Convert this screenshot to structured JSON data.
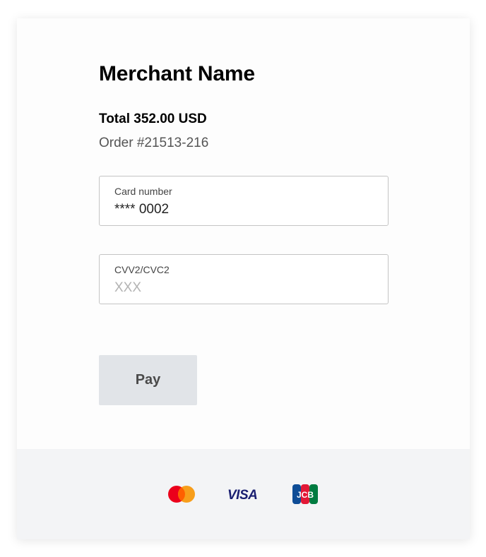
{
  "merchant": {
    "name": "Merchant Name"
  },
  "order": {
    "total": "Total 352.00 USD",
    "number": "Order #21513-216"
  },
  "card_number": {
    "label": "Card number",
    "value": "**** 0002"
  },
  "cvv": {
    "label": "CVV2/CVC2",
    "placeholder": "XXX",
    "value": ""
  },
  "pay_button": {
    "label": "Pay"
  },
  "payment_logos": [
    {
      "name": "mastercard-icon"
    },
    {
      "name": "visa-icon",
      "text": "VISA"
    },
    {
      "name": "jcb-icon",
      "text": "JCB"
    }
  ],
  "colors": {
    "pay_button_bg": "#e1e4e8",
    "footer_bg": "#f3f4f6",
    "mastercard_red": "#eb001b",
    "mastercard_orange": "#f79e1b",
    "visa_blue": "#1a1f71"
  }
}
